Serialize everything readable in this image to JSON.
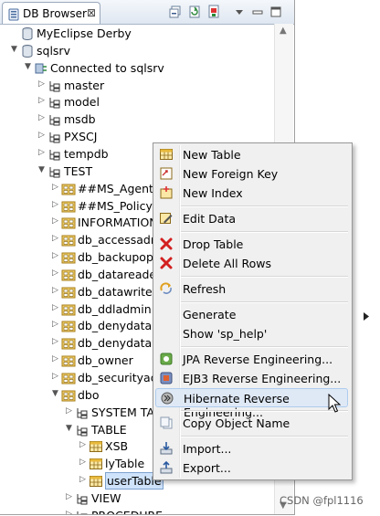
{
  "view": {
    "tab_title": "DB Browser",
    "tab_close": "⊠",
    "toolbar": [
      "collapse-all-icon",
      "refresh-icon",
      "connect-icon",
      "view-menu-icon",
      "minimize-icon",
      "maximize-icon"
    ]
  },
  "tree": [
    {
      "label": "MyEclipse Derby",
      "icon": "database-icon",
      "indent": 0,
      "arrow": ""
    },
    {
      "label": "sqlsrv",
      "icon": "database-icon",
      "indent": 0,
      "arrow": "▼"
    },
    {
      "label": "Connected to sqlsrv",
      "icon": "connection-icon",
      "indent": 1,
      "arrow": "▼"
    },
    {
      "label": "master",
      "icon": "schema-folder-icon",
      "indent": 2,
      "arrow": "▷"
    },
    {
      "label": "model",
      "icon": "schema-folder-icon",
      "indent": 2,
      "arrow": "▷"
    },
    {
      "label": "msdb",
      "icon": "schema-folder-icon",
      "indent": 2,
      "arrow": "▷"
    },
    {
      "label": "PXSCJ",
      "icon": "schema-folder-icon",
      "indent": 2,
      "arrow": "▷"
    },
    {
      "label": "tempdb",
      "icon": "schema-folder-icon",
      "indent": 2,
      "arrow": "▷"
    },
    {
      "label": "TEST",
      "icon": "schema-folder-icon",
      "indent": 2,
      "arrow": "▼"
    },
    {
      "label": "##MS_AgentSig",
      "icon": "schema-icon",
      "indent": 3,
      "arrow": "▷"
    },
    {
      "label": "##MS_PolicyEv",
      "icon": "schema-icon",
      "indent": 3,
      "arrow": "▷"
    },
    {
      "label": "INFORMATION_",
      "icon": "schema-icon",
      "indent": 3,
      "arrow": "▷"
    },
    {
      "label": "db_accessadmi",
      "icon": "schema-icon",
      "indent": 3,
      "arrow": "▷"
    },
    {
      "label": "db_backupope",
      "icon": "schema-icon",
      "indent": 3,
      "arrow": "▷"
    },
    {
      "label": "db_datareader",
      "icon": "schema-icon",
      "indent": 3,
      "arrow": "▷"
    },
    {
      "label": "db_datawriter",
      "icon": "schema-icon",
      "indent": 3,
      "arrow": "▷"
    },
    {
      "label": "db_ddladmin",
      "icon": "schema-icon",
      "indent": 3,
      "arrow": "▷"
    },
    {
      "label": "db_denydatare",
      "icon": "schema-icon",
      "indent": 3,
      "arrow": "▷"
    },
    {
      "label": "db_denydataw",
      "icon": "schema-icon",
      "indent": 3,
      "arrow": "▷"
    },
    {
      "label": "db_owner",
      "icon": "schema-icon",
      "indent": 3,
      "arrow": "▷"
    },
    {
      "label": "db_securityadn",
      "icon": "schema-icon",
      "indent": 3,
      "arrow": "▷"
    },
    {
      "label": "dbo",
      "icon": "schema-icon",
      "indent": 3,
      "arrow": "▼"
    },
    {
      "label": "SYSTEM TAB",
      "icon": "folder-icon",
      "indent": 4,
      "arrow": "▷"
    },
    {
      "label": "TABLE",
      "icon": "folder-icon",
      "indent": 4,
      "arrow": "▼"
    },
    {
      "label": "XSB",
      "icon": "table-icon",
      "indent": 5,
      "arrow": "▷"
    },
    {
      "label": "lyTable",
      "icon": "table-icon",
      "indent": 5,
      "arrow": "▷"
    },
    {
      "label": "userTable",
      "icon": "table-icon",
      "indent": 5,
      "arrow": "▷",
      "selected": true
    },
    {
      "label": "VIEW",
      "icon": "folder-icon",
      "indent": 4,
      "arrow": "▷"
    },
    {
      "label": "PROCEDURE",
      "icon": "folder-icon",
      "indent": 4,
      "arrow": "▷"
    }
  ],
  "context_menu": [
    {
      "label": "New Table",
      "icon": "new-table-icon"
    },
    {
      "label": "New Foreign Key",
      "icon": "foreign-key-icon"
    },
    {
      "label": "New Index",
      "icon": "index-icon"
    },
    {
      "sep": true
    },
    {
      "label": "Edit Data",
      "icon": "edit-data-icon"
    },
    {
      "sep": true
    },
    {
      "label": "Drop Table",
      "icon": "drop-icon"
    },
    {
      "label": "Delete All Rows",
      "icon": "delete-rows-icon"
    },
    {
      "sep": true
    },
    {
      "label": "Refresh",
      "icon": "refresh-icon"
    },
    {
      "sep": true
    },
    {
      "label": "Generate",
      "icon": "",
      "submenu": true
    },
    {
      "label": "Show 'sp_help'",
      "icon": "sp-help-icon"
    },
    {
      "sep": true
    },
    {
      "label": "JPA Reverse Engineering...",
      "icon": "jpa-icon"
    },
    {
      "label": "EJB3 Reverse Engineering...",
      "icon": "ejb3-icon"
    },
    {
      "label": "Hibernate Reverse Engineering...",
      "icon": "hibernate-icon",
      "highlighted": true
    },
    {
      "sep": true
    },
    {
      "label": "Copy Object Name",
      "icon": "copy-icon"
    },
    {
      "sep": true
    },
    {
      "label": "Import...",
      "icon": "import-icon"
    },
    {
      "label": "Export...",
      "icon": "export-icon"
    }
  ],
  "watermark": "CSDN @fpl1116"
}
